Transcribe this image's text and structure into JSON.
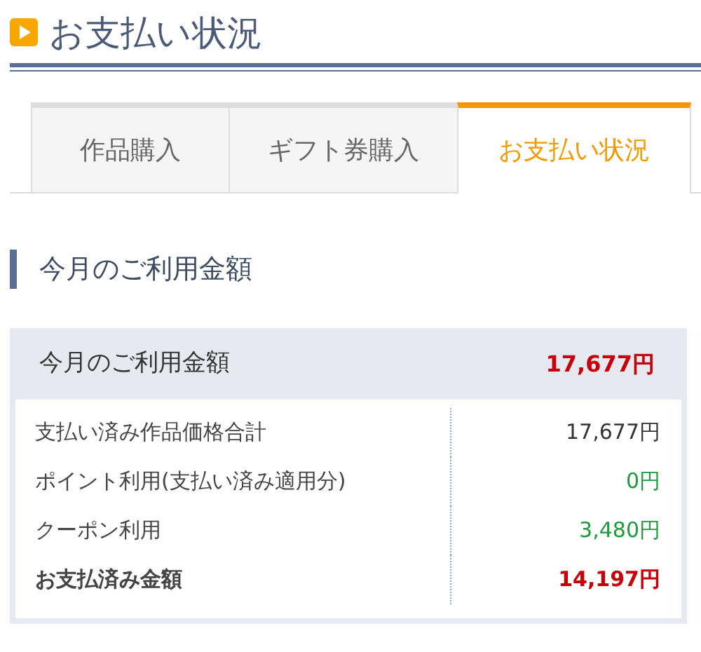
{
  "page_title": "お支払い状況",
  "tabs": [
    {
      "label": "作品購入",
      "selected": false
    },
    {
      "label": "ギフト券購入",
      "selected": false
    },
    {
      "label": "お支払い状況",
      "selected": true
    }
  ],
  "section_heading": "今月のご利用金額",
  "summary": {
    "label": "今月のご利用金額",
    "amount": "17,677円",
    "rows": [
      {
        "kind": "plain",
        "label": "支払い済み作品価格合計",
        "amount": "17,677円"
      },
      {
        "kind": "discount",
        "label": "ポイント利用(支払い済み適用分)",
        "amount": "0円"
      },
      {
        "kind": "discount",
        "label": "クーポン利用",
        "amount": "3,480円"
      },
      {
        "kind": "total",
        "label": "お支払済み金額",
        "amount": "14,197円"
      }
    ]
  }
}
